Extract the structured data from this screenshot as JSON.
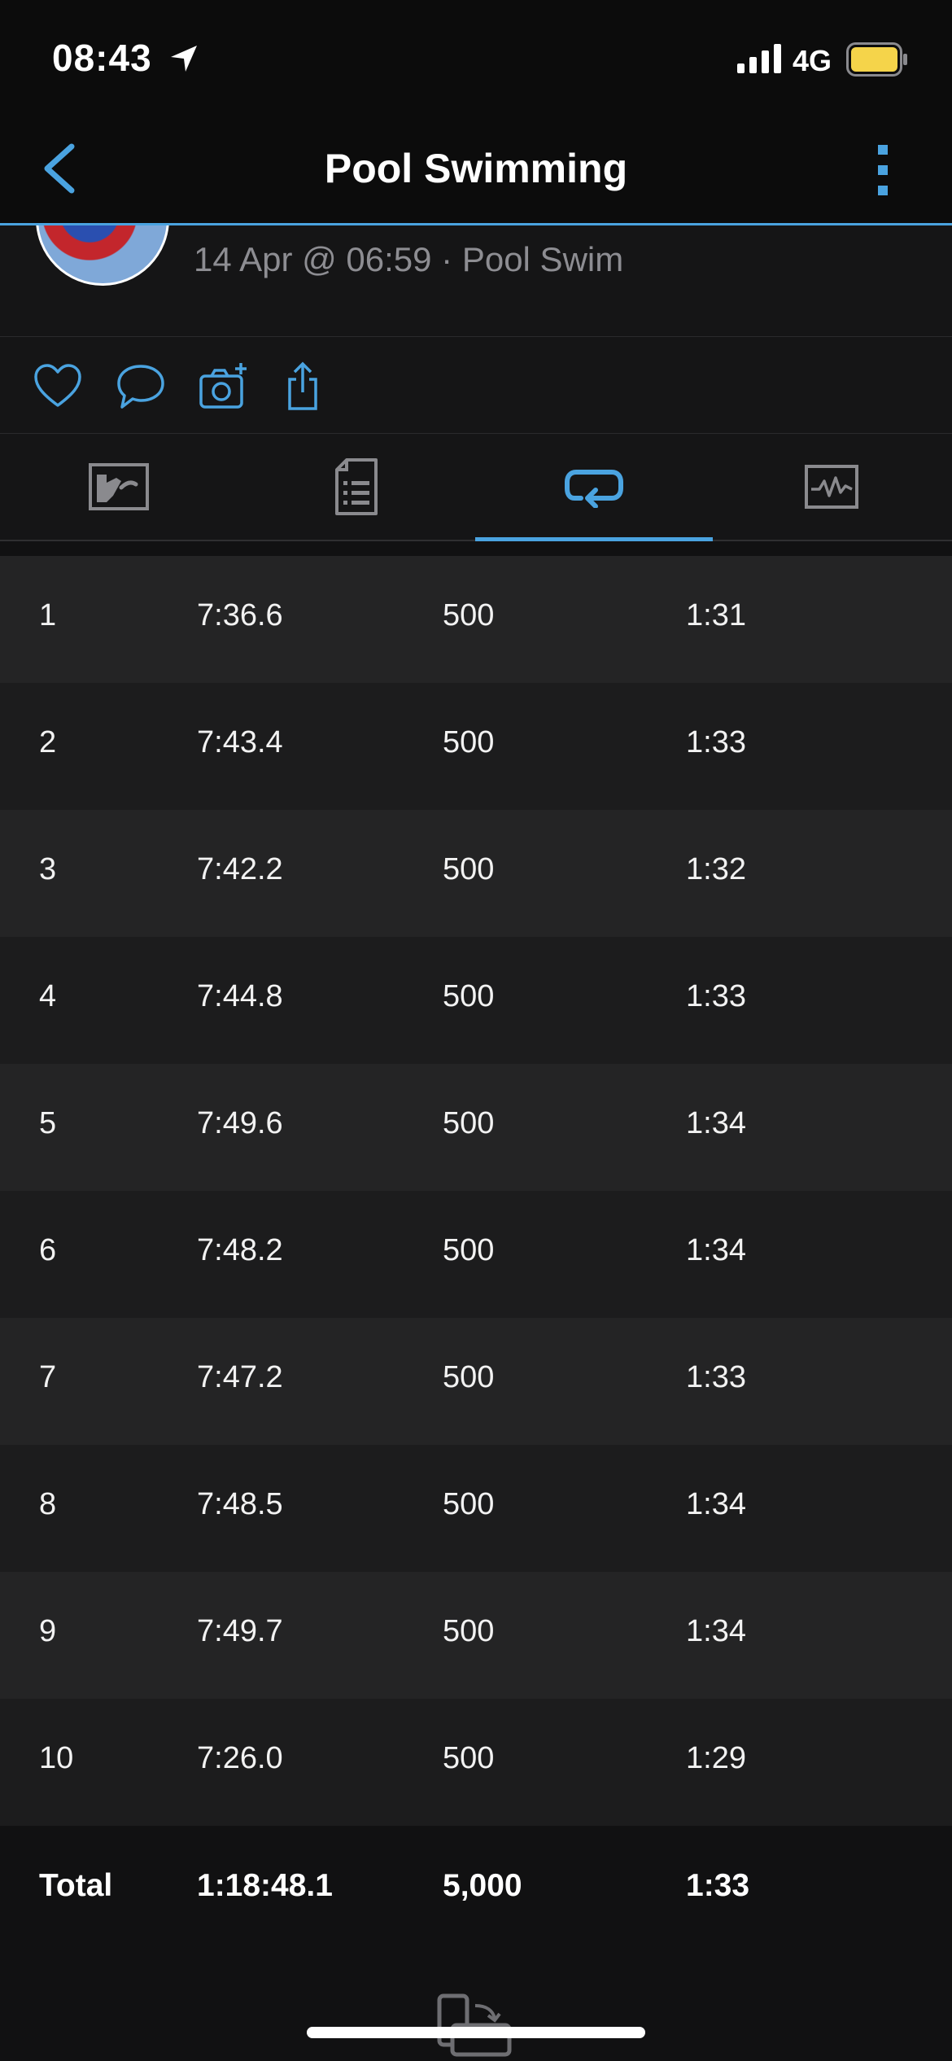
{
  "status_bar": {
    "time": "08:43",
    "network": "4G",
    "icons": [
      "location-arrow-icon",
      "signal-icon",
      "battery-icon"
    ]
  },
  "nav": {
    "title": "Pool Swimming",
    "back_icon": "chevron-left-icon",
    "more_icon": "more-vertical-icon"
  },
  "activity": {
    "subtitle": "14 Apr @ 06:59 · Pool Swim"
  },
  "actions": [
    "heart-icon",
    "comment-icon",
    "add-photo-icon",
    "share-icon"
  ],
  "tabs": [
    {
      "icon": "summary-map-icon",
      "active": false
    },
    {
      "icon": "details-list-icon",
      "active": false
    },
    {
      "icon": "laps-icon",
      "active": true
    },
    {
      "icon": "graph-icon",
      "active": false
    }
  ],
  "laps": [
    {
      "lap": "1",
      "time": "7:36.6",
      "distance": "500",
      "pace": "1:31"
    },
    {
      "lap": "2",
      "time": "7:43.4",
      "distance": "500",
      "pace": "1:33"
    },
    {
      "lap": "3",
      "time": "7:42.2",
      "distance": "500",
      "pace": "1:32"
    },
    {
      "lap": "4",
      "time": "7:44.8",
      "distance": "500",
      "pace": "1:33"
    },
    {
      "lap": "5",
      "time": "7:49.6",
      "distance": "500",
      "pace": "1:34"
    },
    {
      "lap": "6",
      "time": "7:48.2",
      "distance": "500",
      "pace": "1:34"
    },
    {
      "lap": "7",
      "time": "7:47.2",
      "distance": "500",
      "pace": "1:33"
    },
    {
      "lap": "8",
      "time": "7:48.5",
      "distance": "500",
      "pace": "1:34"
    },
    {
      "lap": "9",
      "time": "7:49.7",
      "distance": "500",
      "pace": "1:34"
    },
    {
      "lap": "10",
      "time": "7:26.0",
      "distance": "500",
      "pace": "1:29"
    }
  ],
  "total": {
    "label": "Total",
    "time": "1:18:48.1",
    "distance": "5,000",
    "pace": "1:33"
  },
  "colors": {
    "accent": "#4aa3e0",
    "battery": "#f5d44a",
    "background": "#111112"
  }
}
